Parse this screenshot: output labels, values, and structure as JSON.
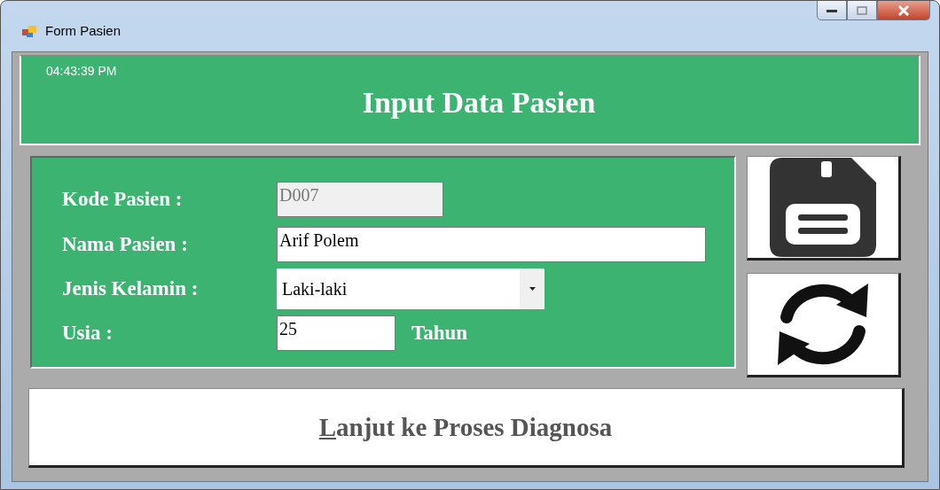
{
  "window": {
    "title": "Form Pasien"
  },
  "header": {
    "clock": "04:43:39 PM",
    "title": "Input Data Pasien"
  },
  "fields": [
    {
      "kind": "text",
      "label": "Kode  Pasien :",
      "value": "D007",
      "disabled": true
    },
    {
      "kind": "text",
      "label": "Nama Pasien :",
      "value": "Arif Polem",
      "disabled": false
    },
    {
      "kind": "select",
      "label": "Jenis Kelamin :",
      "value": "Laki-laki"
    },
    {
      "kind": "text",
      "label": "Usia :",
      "value": "25",
      "disabled": false,
      "suffix": "Tahun"
    }
  ],
  "action_button": {
    "access_key": "L",
    "label_rest": "anjut ke Proses Diagnosa"
  }
}
